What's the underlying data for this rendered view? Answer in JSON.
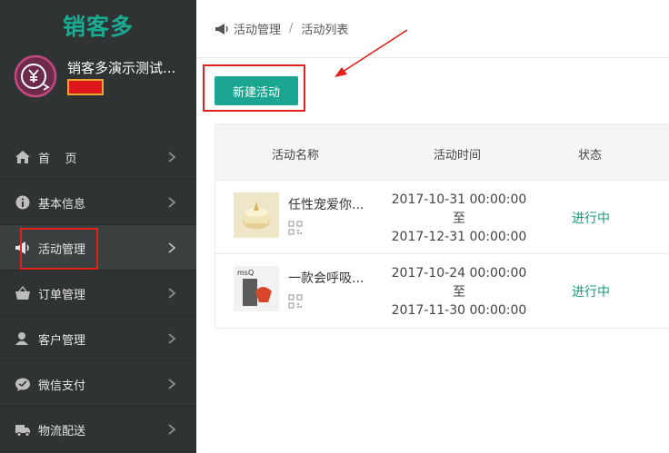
{
  "app": {
    "logo": "销客多",
    "shop_name": "销客多演示测试..."
  },
  "sidebar": {
    "items": [
      {
        "label": "首    页",
        "icon": "home-icon"
      },
      {
        "label": "基本信息",
        "icon": "info-icon"
      },
      {
        "label": "活动管理",
        "icon": "megaphone-icon",
        "active": true
      },
      {
        "label": "订单管理",
        "icon": "basket-icon"
      },
      {
        "label": "客户管理",
        "icon": "user-icon"
      },
      {
        "label": "微信支付",
        "icon": "wechat-icon"
      },
      {
        "label": "物流配送",
        "icon": "truck-icon"
      }
    ]
  },
  "breadcrumb": {
    "icon": "megaphone-icon",
    "parent": "活动管理",
    "separator": "/",
    "current": "活动列表"
  },
  "toolbar": {
    "new_activity_label": "新建活动"
  },
  "table": {
    "headers": {
      "name": "活动名称",
      "time": "活动时间",
      "status": "状态"
    },
    "rows": [
      {
        "name": "任性宠爱你...",
        "start": "2017-10-31 00:00:00",
        "to": "至",
        "end": "2017-12-31 00:00:00",
        "status": "进行中"
      },
      {
        "name": "一款会呼吸...",
        "start": "2017-10-24 00:00:00",
        "to": "至",
        "end": "2017-11-30 00:00:00",
        "status": "进行中"
      }
    ]
  },
  "colors": {
    "accent": "#1aa690",
    "sidebar_bg": "#2f3333",
    "annotation_red": "#e3201b",
    "status_green": "#1a9a7f"
  }
}
